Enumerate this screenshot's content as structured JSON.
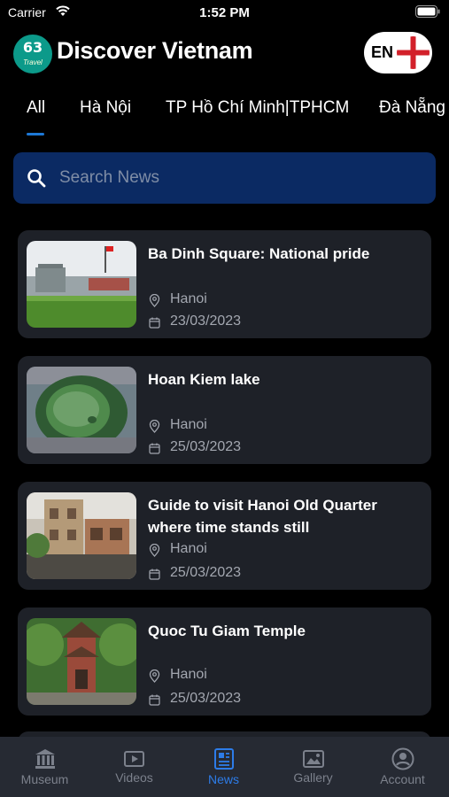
{
  "status": {
    "carrier": "Carrier",
    "time": "1:52 PM"
  },
  "header": {
    "logo_number": "63",
    "logo_sub": "Travel",
    "title": "Discover Vietnam",
    "lang": "EN"
  },
  "tabs": [
    {
      "label": "All",
      "active": true
    },
    {
      "label": "Hà Nội"
    },
    {
      "label": "TP Hồ Chí Minh|TPHCM"
    },
    {
      "label": "Đà Nẵng"
    }
  ],
  "search": {
    "placeholder": "Search News"
  },
  "news": [
    {
      "title": "Ba Dinh Square: National pride",
      "location": "Hanoi",
      "date": "23/03/2023"
    },
    {
      "title": "Hoan Kiem lake",
      "location": "Hanoi",
      "date": "25/03/2023"
    },
    {
      "title": "Guide to visit Hanoi Old Quarter where time stands still",
      "location": "Hanoi",
      "date": "25/03/2023"
    },
    {
      "title": "Quoc Tu Giam Temple",
      "location": "Hanoi",
      "date": "25/03/2023"
    }
  ],
  "nav": [
    {
      "label": "Museum",
      "icon": "museum-icon"
    },
    {
      "label": "Videos",
      "icon": "video-icon"
    },
    {
      "label": "News",
      "icon": "news-icon",
      "active": true
    },
    {
      "label": "Gallery",
      "icon": "gallery-icon"
    },
    {
      "label": "Account",
      "icon": "account-icon"
    }
  ],
  "colors": {
    "background": "#000000",
    "card": "#1e2128",
    "search_bg": "#0b2a63",
    "accent": "#2d7ce8",
    "nav_bg": "#262a33"
  }
}
